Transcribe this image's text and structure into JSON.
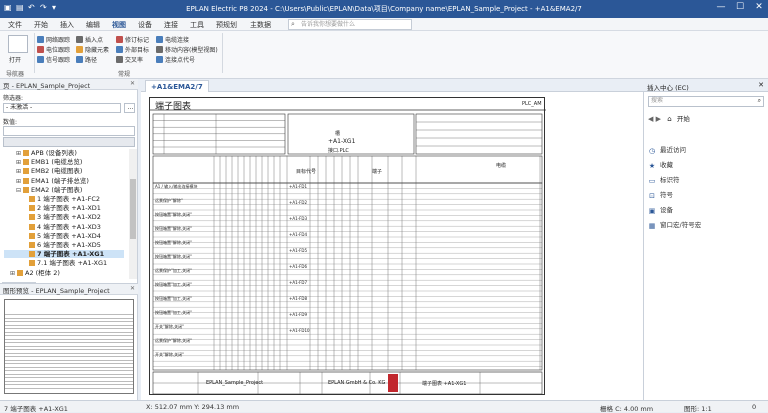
{
  "window": {
    "title": "EPLAN Electric P8 2024 - C:\\Users\\Public\\EPLAN\\Data\\项目\\Company name\\EPLAN_Sample_Project - +A1&EMA2/7",
    "minimize": "—",
    "maximize": "☐",
    "close": "✕"
  },
  "menu": {
    "tabs": [
      "文件",
      "开始",
      "插入",
      "编辑",
      "视图",
      "设备",
      "连接",
      "工具",
      "预规划",
      "主数据"
    ],
    "active_index": 4,
    "search_placeholder": "告诉我你想要做什么"
  },
  "ribbon": {
    "open_label": "打开",
    "navigator_group": "导航器",
    "col1": [
      "网络跟踪",
      "电位跟踪",
      "信号跟踪"
    ],
    "col2": [
      "插入点",
      "隐藏元素",
      "路径"
    ],
    "col3": [
      "修订标记",
      "外部目标",
      "交叉率"
    ],
    "col4": [
      "电缆连接",
      "移动内容(模型视图)",
      "连接点代号"
    ],
    "display_group": "常规"
  },
  "left_panel": {
    "title": "页 - EPLAN_Sample_Project",
    "filter_label": "筛选器:",
    "filter_value": "- 未激活 -",
    "value_label": "数值:",
    "tree": [
      {
        "label": "APB (设备列表)",
        "indent": 2,
        "exp": "⊞"
      },
      {
        "label": "EMB1 (电缆总览)",
        "indent": 2,
        "exp": "⊞"
      },
      {
        "label": "EMB2 (电缆图表)",
        "indent": 2,
        "exp": "⊞"
      },
      {
        "label": "EMA1 (端子排总览)",
        "indent": 2,
        "exp": "⊞"
      },
      {
        "label": "EMA2 (端子图表)",
        "indent": 2,
        "exp": "⊟"
      },
      {
        "label": "1 端子图表 +A1-FC2",
        "indent": 3,
        "exp": ""
      },
      {
        "label": "2 端子图表 +A1-XD1",
        "indent": 3,
        "exp": ""
      },
      {
        "label": "3 端子图表 +A1-XD2",
        "indent": 3,
        "exp": ""
      },
      {
        "label": "4 端子图表 +A1-XD3",
        "indent": 3,
        "exp": ""
      },
      {
        "label": "5 端子图表 +A1-XD4",
        "indent": 3,
        "exp": ""
      },
      {
        "label": "6 端子图表 +A1-XD5",
        "indent": 3,
        "exp": ""
      },
      {
        "label": "7 端子图表 +A1-XG1",
        "indent": 3,
        "exp": "",
        "selected": true
      },
      {
        "label": "7.1 端子图表 +A1-XG1",
        "indent": 3,
        "exp": ""
      },
      {
        "label": "A2 (柜体 2)",
        "indent": 1,
        "exp": "⊞"
      }
    ],
    "bottom_tabs": [
      "树",
      "列表"
    ]
  },
  "preview_panel": {
    "title": "图形预览 - EPLAN_Sample_Project"
  },
  "document": {
    "tab_label": "+A1&EMA2/7",
    "sheet_title": "端子图表",
    "page_ref": "PLC_AM",
    "center_line1": "槽",
    "center_line2": "+A1-XG1",
    "center_line3": "接口.PLC",
    "col_targets": "目标代号",
    "col_terminal": "端子",
    "col_cable": "电缆",
    "left_rows": [
      "A1 / 输入/输出连接模块",
      "远景保护\"解除\"",
      "按钮箱置\"解除,关闭\"",
      "按钮箱置\"解除,关闭\"",
      "按钮箱置\"解除,关闭\"",
      "按钮箱置\"解除,关闭\"",
      "远景保护\"加工,关闭\"",
      "按钮箱置\"加工,关闭\"",
      "按钮箱置\"加工,关闭\"",
      "按钮箱置\"加工,关闭\"",
      "开关\"解除,关闭\"",
      "远景保护\"解除,关闭\"",
      "开关\"解除,关闭\""
    ],
    "target_rows": [
      "+A1-FD1",
      "+A1-FD2",
      "+A1-FD3",
      "+A1-FD4",
      "+A1-FD5",
      "+A1-FD6",
      "+A1-FD7",
      "+A1-FD8",
      "+A1-FD9",
      "+A1-FD10"
    ],
    "footer_company": "EPLAN GmbH & Co. KG",
    "footer_title": "端子图表 +A1-XG1",
    "footer_project": "EPLAN_Sample_Project"
  },
  "right_panel": {
    "title": "插入中心 (EC)",
    "search_placeholder": "搜索",
    "start_label": "开始",
    "items": [
      {
        "label": "最近访问",
        "icon": "clock-icon",
        "glyph": "◷"
      },
      {
        "label": "收藏",
        "icon": "star-icon",
        "glyph": "★"
      },
      {
        "label": "标识符",
        "icon": "tag-icon",
        "glyph": "▭"
      },
      {
        "label": "符号",
        "icon": "symbol-icon",
        "glyph": "⊡"
      },
      {
        "label": "设备",
        "icon": "device-icon",
        "glyph": "▣"
      },
      {
        "label": "窗口宏/符号宏",
        "icon": "macro-icon",
        "glyph": "▦"
      }
    ]
  },
  "status": {
    "left": "7 端子图表 +A1-XG1",
    "coords": "X: 512.07 mm Y: 294.13 mm",
    "grid": "栅格 C: 4.00 mm",
    "scale": "图形: 1:1",
    "off": "0"
  },
  "colors": {
    "title_bar": "#2b5797",
    "accent": "#2b5797"
  }
}
